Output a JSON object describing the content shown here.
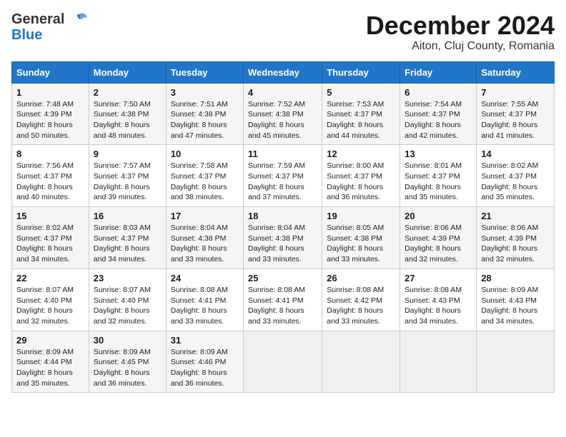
{
  "header": {
    "logo": {
      "line1": "General",
      "line2": "Blue"
    },
    "month": "December 2024",
    "location": "Aiton, Cluj County, Romania"
  },
  "weekdays": [
    "Sunday",
    "Monday",
    "Tuesday",
    "Wednesday",
    "Thursday",
    "Friday",
    "Saturday"
  ],
  "weeks": [
    [
      {
        "day": 1,
        "sunrise": "7:48 AM",
        "sunset": "4:39 PM",
        "daylight": "8 hours and 50 minutes."
      },
      {
        "day": 2,
        "sunrise": "7:50 AM",
        "sunset": "4:38 PM",
        "daylight": "8 hours and 48 minutes."
      },
      {
        "day": 3,
        "sunrise": "7:51 AM",
        "sunset": "4:38 PM",
        "daylight": "8 hours and 47 minutes."
      },
      {
        "day": 4,
        "sunrise": "7:52 AM",
        "sunset": "4:38 PM",
        "daylight": "8 hours and 45 minutes."
      },
      {
        "day": 5,
        "sunrise": "7:53 AM",
        "sunset": "4:37 PM",
        "daylight": "8 hours and 44 minutes."
      },
      {
        "day": 6,
        "sunrise": "7:54 AM",
        "sunset": "4:37 PM",
        "daylight": "8 hours and 42 minutes."
      },
      {
        "day": 7,
        "sunrise": "7:55 AM",
        "sunset": "4:37 PM",
        "daylight": "8 hours and 41 minutes."
      }
    ],
    [
      {
        "day": 8,
        "sunrise": "7:56 AM",
        "sunset": "4:37 PM",
        "daylight": "8 hours and 40 minutes."
      },
      {
        "day": 9,
        "sunrise": "7:57 AM",
        "sunset": "4:37 PM",
        "daylight": "8 hours and 39 minutes."
      },
      {
        "day": 10,
        "sunrise": "7:58 AM",
        "sunset": "4:37 PM",
        "daylight": "8 hours and 38 minutes."
      },
      {
        "day": 11,
        "sunrise": "7:59 AM",
        "sunset": "4:37 PM",
        "daylight": "8 hours and 37 minutes."
      },
      {
        "day": 12,
        "sunrise": "8:00 AM",
        "sunset": "4:37 PM",
        "daylight": "8 hours and 36 minutes."
      },
      {
        "day": 13,
        "sunrise": "8:01 AM",
        "sunset": "4:37 PM",
        "daylight": "8 hours and 35 minutes."
      },
      {
        "day": 14,
        "sunrise": "8:02 AM",
        "sunset": "4:37 PM",
        "daylight": "8 hours and 35 minutes."
      }
    ],
    [
      {
        "day": 15,
        "sunrise": "8:02 AM",
        "sunset": "4:37 PM",
        "daylight": "8 hours and 34 minutes."
      },
      {
        "day": 16,
        "sunrise": "8:03 AM",
        "sunset": "4:37 PM",
        "daylight": "8 hours and 34 minutes."
      },
      {
        "day": 17,
        "sunrise": "8:04 AM",
        "sunset": "4:38 PM",
        "daylight": "8 hours and 33 minutes."
      },
      {
        "day": 18,
        "sunrise": "8:04 AM",
        "sunset": "4:38 PM",
        "daylight": "8 hours and 33 minutes."
      },
      {
        "day": 19,
        "sunrise": "8:05 AM",
        "sunset": "4:38 PM",
        "daylight": "8 hours and 33 minutes."
      },
      {
        "day": 20,
        "sunrise": "8:06 AM",
        "sunset": "4:39 PM",
        "daylight": "8 hours and 32 minutes."
      },
      {
        "day": 21,
        "sunrise": "8:06 AM",
        "sunset": "4:39 PM",
        "daylight": "8 hours and 32 minutes."
      }
    ],
    [
      {
        "day": 22,
        "sunrise": "8:07 AM",
        "sunset": "4:40 PM",
        "daylight": "8 hours and 32 minutes."
      },
      {
        "day": 23,
        "sunrise": "8:07 AM",
        "sunset": "4:40 PM",
        "daylight": "8 hours and 32 minutes."
      },
      {
        "day": 24,
        "sunrise": "8:08 AM",
        "sunset": "4:41 PM",
        "daylight": "8 hours and 33 minutes."
      },
      {
        "day": 25,
        "sunrise": "8:08 AM",
        "sunset": "4:41 PM",
        "daylight": "8 hours and 33 minutes."
      },
      {
        "day": 26,
        "sunrise": "8:08 AM",
        "sunset": "4:42 PM",
        "daylight": "8 hours and 33 minutes."
      },
      {
        "day": 27,
        "sunrise": "8:08 AM",
        "sunset": "4:43 PM",
        "daylight": "8 hours and 34 minutes."
      },
      {
        "day": 28,
        "sunrise": "8:09 AM",
        "sunset": "4:43 PM",
        "daylight": "8 hours and 34 minutes."
      }
    ],
    [
      {
        "day": 29,
        "sunrise": "8:09 AM",
        "sunset": "4:44 PM",
        "daylight": "8 hours and 35 minutes."
      },
      {
        "day": 30,
        "sunrise": "8:09 AM",
        "sunset": "4:45 PM",
        "daylight": "8 hours and 36 minutes."
      },
      {
        "day": 31,
        "sunrise": "8:09 AM",
        "sunset": "4:46 PM",
        "daylight": "8 hours and 36 minutes."
      },
      null,
      null,
      null,
      null
    ]
  ]
}
